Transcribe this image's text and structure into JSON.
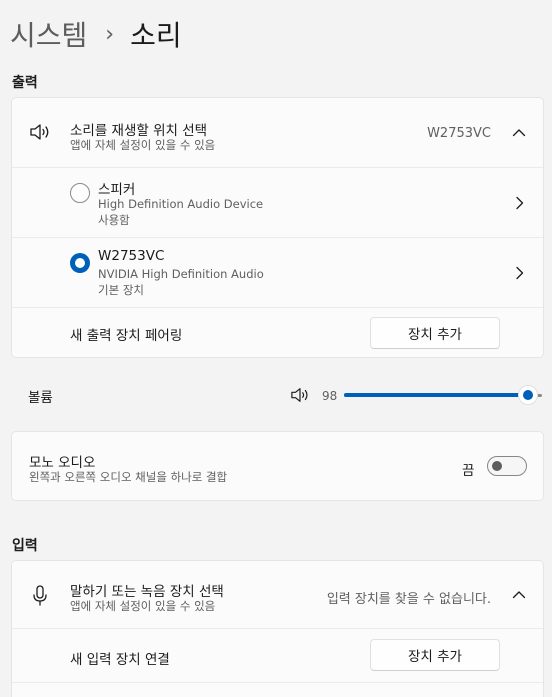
{
  "breadcrumb": {
    "parent": "시스템",
    "separator": "›",
    "current": "소리"
  },
  "output": {
    "section_title": "출력",
    "location_title": "소리를 재생할 위치 선택",
    "location_subtitle": "앱에 자체 설정이 있을 수 있음",
    "location_value": "W2753VC",
    "devices": [
      {
        "name": "스피커",
        "description": "High Definition Audio Device",
        "status": "사용함",
        "selected": false
      },
      {
        "name": "W2753VC",
        "description": "NVIDIA High Definition Audio",
        "status": "기본 장치",
        "selected": true
      }
    ],
    "pair_label": "새 출력 장치 페어링",
    "add_device_button": "장치 추가"
  },
  "volume": {
    "label": "볼륨",
    "value": "98",
    "level": 0.98
  },
  "mono_audio": {
    "title": "모노 오디오",
    "subtitle": "왼쪽과 오른쪽 오디오 채널을 하나로 결합",
    "state_label": "끔",
    "on": false
  },
  "input": {
    "section_title": "입력",
    "select_title": "말하기 또는 녹음 장치 선택",
    "select_subtitle": "앱에 자체 설정이 있을 수 있음",
    "select_value": "입력 장치를 찾을 수 없습니다.",
    "connect_label": "새 입력 장치 연결",
    "add_device_button": "장치 추가"
  },
  "colors": {
    "accent": "#005fb8",
    "background": "#f3f3f3",
    "card": "#fbfbfb"
  },
  "icons": [
    "speaker-icon",
    "chevron-up-icon",
    "chevron-right-icon",
    "microphone-icon"
  ]
}
